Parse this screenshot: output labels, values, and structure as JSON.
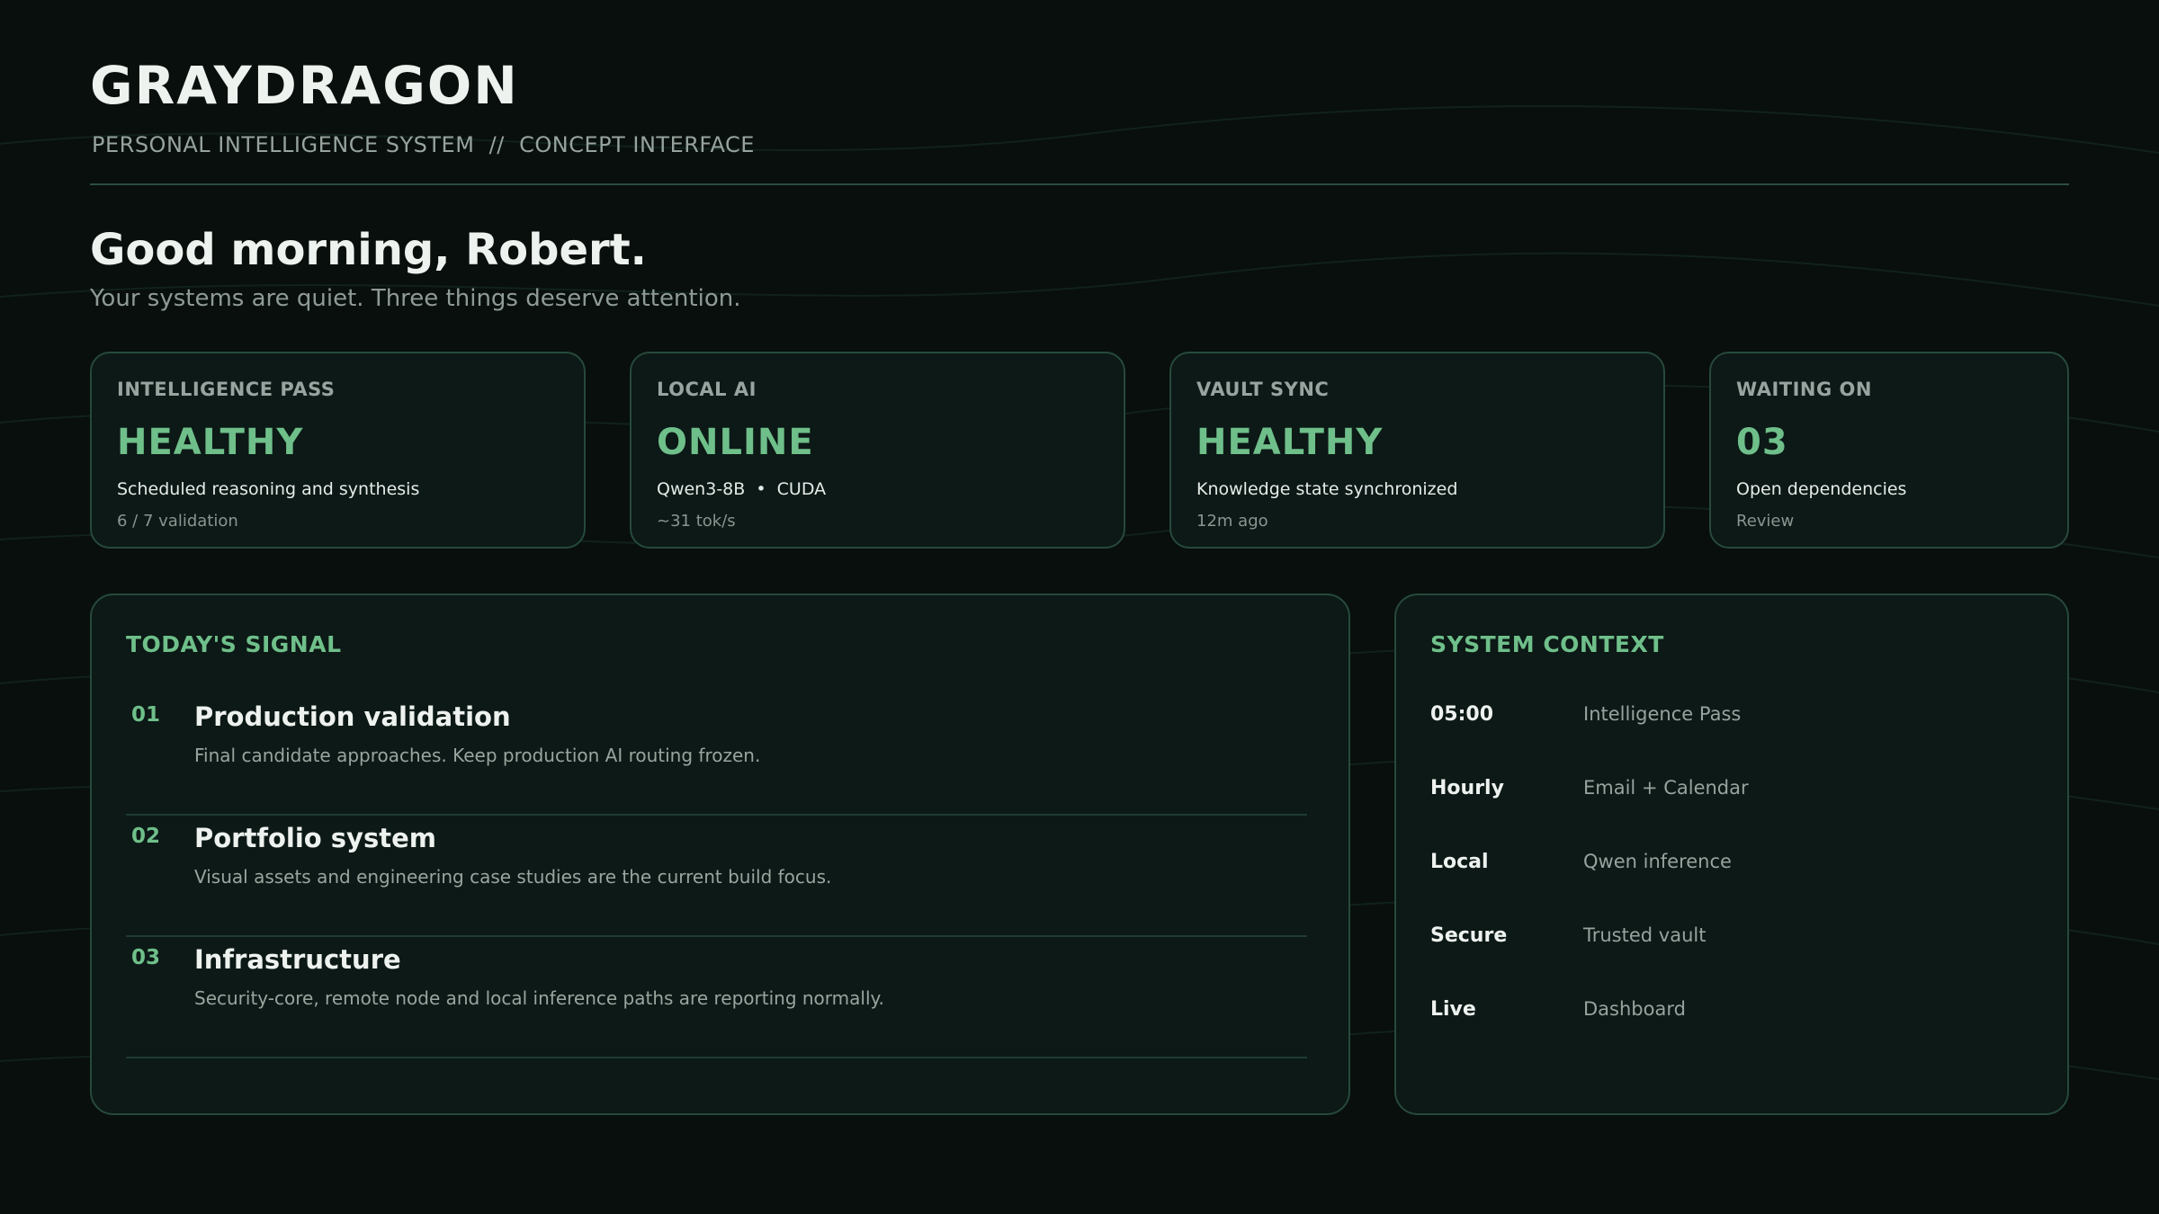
{
  "header": {
    "brand": "GRAYDRAGON",
    "tagline": "PERSONAL INTELLIGENCE SYSTEM  //  CONCEPT INTERFACE"
  },
  "greeting": {
    "title": "Good morning, Robert.",
    "subtitle": "Your systems are quiet. Three things deserve attention."
  },
  "cards": [
    {
      "label": "INTELLIGENCE PASS",
      "status": "HEALTHY",
      "desc": "Scheduled reasoning and synthesis",
      "meta": "6 / 7 validation"
    },
    {
      "label": "LOCAL AI",
      "status": "ONLINE",
      "desc": "Qwen3-8B  •  CUDA",
      "meta": "~31 tok/s"
    },
    {
      "label": "VAULT SYNC",
      "status": "HEALTHY",
      "desc": "Knowledge state synchronized",
      "meta": "12m ago"
    },
    {
      "label": "WAITING ON",
      "status": "03",
      "desc": "Open dependencies",
      "meta": "Review"
    }
  ],
  "signal": {
    "title": "TODAY'S SIGNAL",
    "items": [
      {
        "num": "01",
        "title": "Production validation",
        "desc": "Final candidate approaches. Keep production AI routing frozen."
      },
      {
        "num": "02",
        "title": "Portfolio system",
        "desc": "Visual assets and engineering case studies are the current build focus."
      },
      {
        "num": "03",
        "title": "Infrastructure",
        "desc": "Security-core, remote node and local inference paths are reporting normally."
      }
    ]
  },
  "context": {
    "title": "SYSTEM CONTEXT",
    "rows": [
      {
        "key": "05:00",
        "value": "Intelligence Pass"
      },
      {
        "key": "Hourly",
        "value": "Email + Calendar"
      },
      {
        "key": "Local",
        "value": "Qwen inference"
      },
      {
        "key": "Secure",
        "value": "Trusted vault"
      },
      {
        "key": "Live",
        "value": "Dashboard"
      }
    ]
  },
  "colors": {
    "background": "#080f0d",
    "panel": "#0c1916",
    "border": "#27493c",
    "accent": "#6fbf8a"
  }
}
